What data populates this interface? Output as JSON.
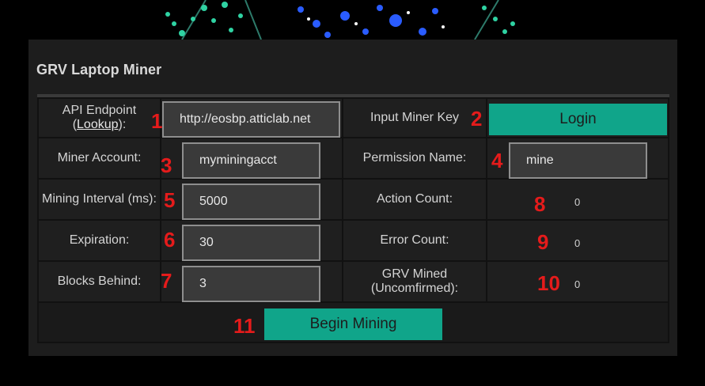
{
  "app": {
    "title": "GRV Laptop Miner"
  },
  "fields": {
    "api_endpoint": {
      "label_pre": "API Endpoint",
      "label_paren_open": "(",
      "lookup_link": "Lookup",
      "label_paren_close": "):",
      "value": "http://eosbp.atticlab.net"
    },
    "miner_key": {
      "label": "Input Miner Key"
    },
    "miner_account": {
      "label": "Miner Account:",
      "value": "myminingacct"
    },
    "permission_name": {
      "label": "Permission Name:",
      "value": "mine"
    },
    "mining_interval": {
      "label": "Mining Interval (ms):",
      "value": "5000"
    },
    "expiration": {
      "label": "Expiration:",
      "value": "30"
    },
    "blocks_behind": {
      "label": "Blocks Behind:",
      "value": "3"
    }
  },
  "stats": {
    "action_count": {
      "label": "Action Count:",
      "value": "0"
    },
    "error_count": {
      "label": "Error Count:",
      "value": "0"
    },
    "grv_mined": {
      "label_line1": "GRV Mined",
      "label_line2": "(Uncomfirmed):",
      "value": "0"
    }
  },
  "buttons": {
    "login": "Login",
    "begin_mining": "Begin Mining"
  },
  "annotations": [
    "1",
    "2",
    "3",
    "4",
    "5",
    "6",
    "7",
    "8",
    "9",
    "10",
    "11"
  ],
  "colors": {
    "accent": "#10a58a",
    "annotation": "#e51b1b",
    "panel": "#1d1d1d",
    "background": "#000000"
  }
}
